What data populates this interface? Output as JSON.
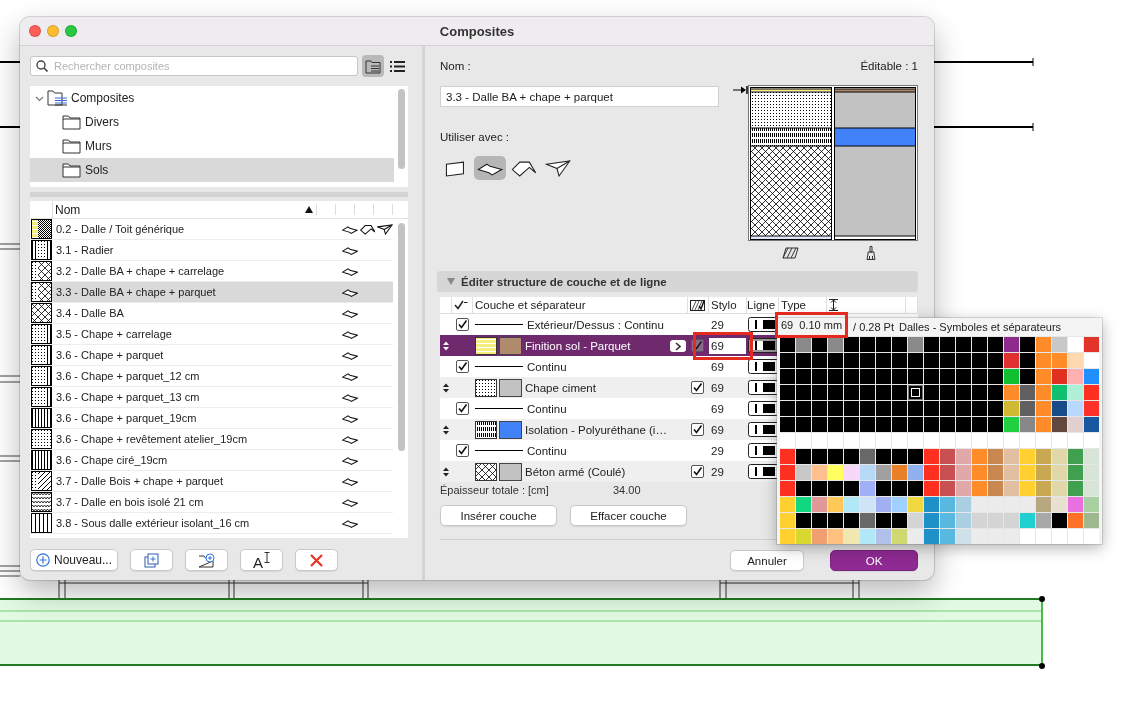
{
  "window": {
    "title": "Composites"
  },
  "search": {
    "placeholder": "Rechercher composites"
  },
  "view_toggle": [
    {
      "kind": "tree",
      "selected": true
    },
    {
      "kind": "list",
      "selected": false
    }
  ],
  "tree": [
    {
      "label": "Composites",
      "expanded": true,
      "selected": false,
      "children": [
        {
          "label": "Divers",
          "selected": false
        },
        {
          "label": "Murs",
          "selected": false
        },
        {
          "label": "Sols",
          "selected": true
        }
      ]
    }
  ],
  "list": {
    "columns": [
      "Nom"
    ],
    "rows": [
      {
        "name": "0.2 - Dalle / Toit générique",
        "kind": "mixed",
        "roof": true,
        "shell": true,
        "selected": false
      },
      {
        "name": "3.1 - Radier",
        "kind": "radier",
        "roof": false,
        "shell": false,
        "selected": false
      },
      {
        "name": "3.2 - Dalle BA + chape + carrelage",
        "kind": "cross",
        "roof": false,
        "shell": false,
        "selected": false
      },
      {
        "name": "3.3 - Dalle BA + chape + parquet",
        "kind": "cross",
        "roof": false,
        "shell": false,
        "selected": true
      },
      {
        "name": "3.4 - Dalle BA",
        "kind": "xcross",
        "roof": false,
        "shell": false,
        "selected": false
      },
      {
        "name": "3.5 - Chape + carrelage",
        "kind": "dots",
        "roof": false,
        "shell": false,
        "selected": false
      },
      {
        "name": "3.6 - Chape + parquet",
        "kind": "dots",
        "roof": false,
        "shell": false,
        "selected": false
      },
      {
        "name": "3.6 - Chape + parquet_12 cm",
        "kind": "dots",
        "roof": false,
        "shell": false,
        "selected": false
      },
      {
        "name": "3.6 - Chape + parquet_13 cm",
        "kind": "dots",
        "roof": false,
        "shell": false,
        "selected": false
      },
      {
        "name": "3.6 - Chape + parquet_19cm",
        "kind": "stripes",
        "roof": false,
        "shell": false,
        "selected": false
      },
      {
        "name": "3.6 - Chape + revêtement atelier_19cm",
        "kind": "speckle",
        "roof": false,
        "shell": false,
        "selected": false
      },
      {
        "name": "3.6 - Chape ciré_19cm",
        "kind": "stripes",
        "roof": false,
        "shell": false,
        "selected": false
      },
      {
        "name": "3.7 - Dalle Bois + chape + parquet",
        "kind": "diagonal",
        "roof": false,
        "shell": false,
        "selected": false
      },
      {
        "name": "3.7 - Dalle en bois isolé 21 cm",
        "kind": "zigzag",
        "roof": false,
        "shell": false,
        "selected": false
      },
      {
        "name": "3.8 - Sous dalle extérieur isolant_16 cm",
        "kind": "lines",
        "roof": false,
        "shell": false,
        "selected": false
      }
    ]
  },
  "left_buttons": [
    {
      "kind": "new",
      "label": "Nouveau..."
    },
    {
      "kind": "duplicate"
    },
    {
      "kind": "new-folder"
    },
    {
      "kind": "rename",
      "label": "A"
    },
    {
      "kind": "delete"
    }
  ],
  "editor": {
    "name_label": "Nom :",
    "editable": "Éditable : 1",
    "name": "3.3 - Dalle BA + chape + parquet",
    "use_with_label": "Utiliser avec :",
    "use_with": [
      {
        "kind": "wall",
        "selected": false
      },
      {
        "kind": "slab",
        "selected": true
      },
      {
        "kind": "roof",
        "selected": false
      },
      {
        "kind": "shell",
        "selected": false
      }
    ]
  },
  "section": {
    "title": "Éditer structure de couche et de ligne",
    "expanded": true
  },
  "layers": {
    "columns": [
      "Couche et séparateur",
      "Stylo",
      "Ligne",
      "Type"
    ],
    "rows": [
      {
        "kind": "line",
        "name": "Extérieur/Dessus : Continu",
        "checked": true,
        "pen": "29",
        "selected": false,
        "highlighted": false
      },
      {
        "kind": "layer",
        "name": "Finition sol - Parquet",
        "color": "#b08a6c",
        "checked": true,
        "pen": "69",
        "selected": true,
        "highlighted": true
      },
      {
        "kind": "line",
        "name": "Continu",
        "checked": true,
        "pen": "69",
        "selected": false,
        "highlighted": false
      },
      {
        "kind": "layer",
        "name": "Chape ciment",
        "color": "#c2c2c2",
        "checked": true,
        "pen": "69",
        "selected": false,
        "highlighted": false
      },
      {
        "kind": "line",
        "name": "Continu",
        "checked": true,
        "pen": "69",
        "selected": false,
        "highlighted": false
      },
      {
        "kind": "layer",
        "name": "Isolation - Polyuréthane (i…",
        "color": "#4282f8",
        "checked": true,
        "pen": "69",
        "selected": false,
        "highlighted": false
      },
      {
        "kind": "line",
        "name": "Continu",
        "checked": true,
        "pen": "29",
        "selected": false,
        "highlighted": false
      },
      {
        "kind": "layer",
        "name": "Béton armé (Coulé)",
        "color": "#c2c2c2",
        "checked": true,
        "pen": "29",
        "selected": false,
        "highlighted": false
      }
    ]
  },
  "total": {
    "label": "Épaisseur totale : [cm]",
    "value": "34.00"
  },
  "layer_buttons": [
    "Insérer couche",
    "Effacer couche"
  ],
  "footer_buttons": [
    {
      "kind": "cancel",
      "label": "Annuler"
    },
    {
      "kind": "ok",
      "label": "OK"
    }
  ],
  "pen_popup": {
    "pen": "69",
    "width": "0.10 mm",
    "points": "/ 0.28 Pt",
    "set": "Dalles - Symboles et séparateurs",
    "highlighted": true,
    "rows": [
      [
        {
          "color": "#000000",
          "selected": false
        },
        {
          "color": "#8a8a8a",
          "selected": false
        },
        {
          "color": "#000000",
          "selected": false
        },
        {
          "color": "#8a8a8a",
          "selected": false
        },
        {
          "color": "#000000",
          "selected": false
        },
        {
          "color": "#000000",
          "selected": false
        },
        {
          "color": "#000000",
          "selected": false
        },
        {
          "color": "#000000",
          "selected": false
        },
        {
          "color": "#8a8a8a",
          "selected": false
        },
        {
          "color": "#000000",
          "selected": false
        },
        {
          "color": "#000000",
          "selected": false
        },
        {
          "color": "#000000",
          "selected": false
        },
        {
          "color": "#000000",
          "selected": false
        },
        {
          "color": "#000000",
          "selected": false
        },
        {
          "color": "#8e2a8e",
          "selected": false
        },
        {
          "color": "#000000",
          "selected": false
        },
        {
          "color": "#ff8c28",
          "selected": false
        },
        {
          "color": "#c8c8c8",
          "selected": false
        },
        {
          "color": "#ffffff",
          "selected": false
        },
        {
          "color": "#e3342a",
          "selected": false
        }
      ],
      [
        {
          "color": "#000000",
          "selected": false
        },
        {
          "color": "#000000",
          "selected": false
        },
        {
          "color": "#000000",
          "selected": false
        },
        {
          "color": "#000000",
          "selected": false
        },
        {
          "color": "#000000",
          "selected": false
        },
        {
          "color": "#000000",
          "selected": false
        },
        {
          "color": "#000000",
          "selected": false
        },
        {
          "color": "#000000",
          "selected": false
        },
        {
          "color": "#000000",
          "selected": false
        },
        {
          "color": "#000000",
          "selected": false
        },
        {
          "color": "#000000",
          "selected": false
        },
        {
          "color": "#000000",
          "selected": false
        },
        {
          "color": "#000000",
          "selected": false
        },
        {
          "color": "#000000",
          "selected": false
        },
        {
          "color": "#e03030",
          "selected": false
        },
        {
          "color": "#000000",
          "selected": false
        },
        {
          "color": "#ff8c28",
          "selected": false
        },
        {
          "color": "#ff8c28",
          "selected": false
        },
        {
          "color": "#ffd8b0",
          "selected": false
        },
        {
          "color": "#ffffff",
          "selected": false
        }
      ],
      [
        {
          "color": "#000000",
          "selected": false
        },
        {
          "color": "#000000",
          "selected": false
        },
        {
          "color": "#000000",
          "selected": false
        },
        {
          "color": "#000000",
          "selected": false
        },
        {
          "color": "#000000",
          "selected": false
        },
        {
          "color": "#000000",
          "selected": false
        },
        {
          "color": "#000000",
          "selected": false
        },
        {
          "color": "#000000",
          "selected": false
        },
        {
          "color": "#000000",
          "selected": false
        },
        {
          "color": "#000000",
          "selected": false
        },
        {
          "color": "#000000",
          "selected": false
        },
        {
          "color": "#000000",
          "selected": false
        },
        {
          "color": "#000000",
          "selected": false
        },
        {
          "color": "#000000",
          "selected": false
        },
        {
          "color": "#10c030",
          "selected": false
        },
        {
          "color": "#000000",
          "selected": false
        },
        {
          "color": "#ff8c28",
          "selected": false
        },
        {
          "color": "#e03020",
          "selected": false
        },
        {
          "color": "#ffb0b0",
          "selected": false
        },
        {
          "color": "#2090ff",
          "selected": false
        }
      ],
      [
        {
          "color": "#000000",
          "selected": false
        },
        {
          "color": "#000000",
          "selected": false
        },
        {
          "color": "#000000",
          "selected": false
        },
        {
          "color": "#000000",
          "selected": false
        },
        {
          "color": "#000000",
          "selected": false
        },
        {
          "color": "#000000",
          "selected": false
        },
        {
          "color": "#000000",
          "selected": false
        },
        {
          "color": "#000000",
          "selected": false
        },
        {
          "color": "#000000",
          "selected": true
        },
        {
          "color": "#000000",
          "selected": false
        },
        {
          "color": "#000000",
          "selected": false
        },
        {
          "color": "#000000",
          "selected": false
        },
        {
          "color": "#000000",
          "selected": false
        },
        {
          "color": "#000000",
          "selected": false
        },
        {
          "color": "#ff8c28",
          "selected": false
        },
        {
          "color": "#606060",
          "selected": false
        },
        {
          "color": "#ff8c28",
          "selected": false
        },
        {
          "color": "#10c070",
          "selected": false
        },
        {
          "color": "#b0f0d8",
          "selected": false
        },
        {
          "color": "#ff3020",
          "selected": false
        }
      ],
      [
        {
          "color": "#000000",
          "selected": false
        },
        {
          "color": "#000000",
          "selected": false
        },
        {
          "color": "#000000",
          "selected": false
        },
        {
          "color": "#000000",
          "selected": false
        },
        {
          "color": "#000000",
          "selected": false
        },
        {
          "color": "#000000",
          "selected": false
        },
        {
          "color": "#000000",
          "selected": false
        },
        {
          "color": "#000000",
          "selected": false
        },
        {
          "color": "#000000",
          "selected": false
        },
        {
          "color": "#000000",
          "selected": false
        },
        {
          "color": "#000000",
          "selected": false
        },
        {
          "color": "#000000",
          "selected": false
        },
        {
          "color": "#000000",
          "selected": false
        },
        {
          "color": "#000000",
          "selected": false
        },
        {
          "color": "#d0b830",
          "selected": false
        },
        {
          "color": "#606060",
          "selected": false
        },
        {
          "color": "#ff8c28",
          "selected": false
        },
        {
          "color": "#184c88",
          "selected": false
        },
        {
          "color": "#b8d8ff",
          "selected": false
        },
        {
          "color": "#ff3028",
          "selected": false
        }
      ],
      [
        {
          "color": "#000000",
          "selected": false
        },
        {
          "color": "#000000",
          "selected": false
        },
        {
          "color": "#000000",
          "selected": false
        },
        {
          "color": "#000000",
          "selected": false
        },
        {
          "color": "#000000",
          "selected": false
        },
        {
          "color": "#000000",
          "selected": false
        },
        {
          "color": "#000000",
          "selected": false
        },
        {
          "color": "#000000",
          "selected": false
        },
        {
          "color": "#000000",
          "selected": false
        },
        {
          "color": "#000000",
          "selected": false
        },
        {
          "color": "#000000",
          "selected": false
        },
        {
          "color": "#000000",
          "selected": false
        },
        {
          "color": "#000000",
          "selected": false
        },
        {
          "color": "#000000",
          "selected": false
        },
        {
          "color": "#20d040",
          "selected": false
        },
        {
          "color": "#888888",
          "selected": false
        },
        {
          "color": "#ff8c28",
          "selected": false
        },
        {
          "color": "#604840",
          "selected": false
        },
        {
          "color": "#e0d0d0",
          "selected": false
        },
        {
          "color": "#1858a0",
          "selected": false
        }
      ],
      [
        {
          "color": "#ffffff",
          "selected": false
        },
        {
          "color": "#ffffff",
          "selected": false
        },
        {
          "color": "#ffffff",
          "selected": false
        },
        {
          "color": "#ffffff",
          "selected": false
        },
        {
          "color": "#ffffff",
          "selected": false
        },
        {
          "color": "#ffffff",
          "selected": false
        },
        {
          "color": "#ffffff",
          "selected": false
        },
        {
          "color": "#ffffff",
          "selected": false
        },
        {
          "color": "#ffffff",
          "selected": false
        },
        {
          "color": "#ffffff",
          "selected": false
        },
        {
          "color": "#ffffff",
          "selected": false
        },
        {
          "color": "#ffffff",
          "selected": false
        },
        {
          "color": "#ffffff",
          "selected": false
        },
        {
          "color": "#ffffff",
          "selected": false
        },
        {
          "color": "#ffffff",
          "selected": false
        },
        {
          "color": "#ffffff",
          "selected": false
        },
        {
          "color": "#ffffff",
          "selected": false
        },
        {
          "color": "#ffffff",
          "selected": false
        },
        {
          "color": "#ffffff",
          "selected": false
        },
        {
          "color": "#ffffff",
          "selected": false
        }
      ],
      [
        {
          "color": "#ff3020",
          "selected": false
        },
        {
          "color": "#000000",
          "selected": false
        },
        {
          "color": "#000000",
          "selected": false
        },
        {
          "color": "#000000",
          "selected": false
        },
        {
          "color": "#000000",
          "selected": false
        },
        {
          "color": "#686868",
          "selected": false
        },
        {
          "color": "#000000",
          "selected": false
        },
        {
          "color": "#000000",
          "selected": false
        },
        {
          "color": "#000000",
          "selected": false
        },
        {
          "color": "#ff3020",
          "selected": false
        },
        {
          "color": "#c85050",
          "selected": false
        },
        {
          "color": "#e0a8a8",
          "selected": false
        },
        {
          "color": "#ff8c28",
          "selected": false
        },
        {
          "color": "#c88850",
          "selected": false
        },
        {
          "color": "#e0c0a0",
          "selected": false
        },
        {
          "color": "#ffd030",
          "selected": false
        },
        {
          "color": "#c8a850",
          "selected": false
        },
        {
          "color": "#e0d8a8",
          "selected": false
        },
        {
          "color": "#40a050",
          "selected": false
        },
        {
          "color": "#d8e4d8",
          "selected": false
        }
      ],
      [
        {
          "color": "#ff3020",
          "selected": false
        },
        {
          "color": "#c8c8c8",
          "selected": false
        },
        {
          "color": "#ffc090",
          "selected": false
        },
        {
          "color": "#ffff60",
          "selected": false
        },
        {
          "color": "#f8d8f8",
          "selected": false
        },
        {
          "color": "#b8d8f8",
          "selected": false
        },
        {
          "color": "#a0a0a0",
          "selected": false
        },
        {
          "color": "#e88028",
          "selected": false
        },
        {
          "color": "#90b0f0",
          "selected": false
        },
        {
          "color": "#ff3020",
          "selected": false
        },
        {
          "color": "#c85050",
          "selected": false
        },
        {
          "color": "#e0a8a8",
          "selected": false
        },
        {
          "color": "#ff8c28",
          "selected": false
        },
        {
          "color": "#c88850",
          "selected": false
        },
        {
          "color": "#e0c0a0",
          "selected": false
        },
        {
          "color": "#ffd030",
          "selected": false
        },
        {
          "color": "#c8a850",
          "selected": false
        },
        {
          "color": "#e0d8a8",
          "selected": false
        },
        {
          "color": "#40a050",
          "selected": false
        },
        {
          "color": "#d8e4d8",
          "selected": false
        }
      ],
      [
        {
          "color": "#ff3020",
          "selected": false
        },
        {
          "color": "#000000",
          "selected": false
        },
        {
          "color": "#000000",
          "selected": false
        },
        {
          "color": "#000000",
          "selected": false
        },
        {
          "color": "#000000",
          "selected": false
        },
        {
          "color": "#a0b0f8",
          "selected": false
        },
        {
          "color": "#000000",
          "selected": false
        },
        {
          "color": "#000000",
          "selected": false
        },
        {
          "color": "#000000",
          "selected": false
        },
        {
          "color": "#ff3020",
          "selected": false
        },
        {
          "color": "#c85050",
          "selected": false
        },
        {
          "color": "#e0a8a8",
          "selected": false
        },
        {
          "color": "#ff8c28",
          "selected": false
        },
        {
          "color": "#c88850",
          "selected": false
        },
        {
          "color": "#e0c0a0",
          "selected": false
        },
        {
          "color": "#ffd030",
          "selected": false
        },
        {
          "color": "#c8a850",
          "selected": false
        },
        {
          "color": "#e0d8a8",
          "selected": false
        },
        {
          "color": "#40a050",
          "selected": false
        },
        {
          "color": "#d8e4d8",
          "selected": false
        }
      ],
      [
        {
          "color": "#ffd030",
          "selected": false
        },
        {
          "color": "#10d880",
          "selected": false
        },
        {
          "color": "#e09898",
          "selected": false
        },
        {
          "color": "#ffc858",
          "selected": false
        },
        {
          "color": "#b0e8f8",
          "selected": false
        },
        {
          "color": "#d0e4f8",
          "selected": false
        },
        {
          "color": "#a0b0f0",
          "selected": false
        },
        {
          "color": "#a0d0ff",
          "selected": false
        },
        {
          "color": "#f0d840",
          "selected": false
        },
        {
          "color": "#2090c8",
          "selected": false
        },
        {
          "color": "#58b8e0",
          "selected": false
        },
        {
          "color": "#a8d0e0",
          "selected": false
        },
        {
          "color": "#ececec",
          "selected": false
        },
        {
          "color": "#ececec",
          "selected": false
        },
        {
          "color": "#ececec",
          "selected": false
        },
        {
          "color": "#ececec",
          "selected": false
        },
        {
          "color": "#b8a880",
          "selected": false
        },
        {
          "color": "#e8e0d0",
          "selected": false
        },
        {
          "color": "#e870e0",
          "selected": false
        },
        {
          "color": "#a8d0a0",
          "selected": false
        }
      ],
      [
        {
          "color": "#ffd030",
          "selected": false
        },
        {
          "color": "#000000",
          "selected": false
        },
        {
          "color": "#000000",
          "selected": false
        },
        {
          "color": "#000000",
          "selected": false
        },
        {
          "color": "#000000",
          "selected": false
        },
        {
          "color": "#686868",
          "selected": false
        },
        {
          "color": "#000000",
          "selected": false
        },
        {
          "color": "#000000",
          "selected": false
        },
        {
          "color": "#d4d4d4",
          "selected": false
        },
        {
          "color": "#2090c8",
          "selected": false
        },
        {
          "color": "#58b8e0",
          "selected": false
        },
        {
          "color": "#a8d0e0",
          "selected": false
        },
        {
          "color": "#d4d4d4",
          "selected": false
        },
        {
          "color": "#d4d4d4",
          "selected": false
        },
        {
          "color": "#d4d4d4",
          "selected": false
        },
        {
          "color": "#20d0d0",
          "selected": false
        },
        {
          "color": "#a8a8a8",
          "selected": false
        },
        {
          "color": "#000000",
          "selected": false
        },
        {
          "color": "#ff7028",
          "selected": false
        },
        {
          "color": "#a0b890",
          "selected": false
        }
      ],
      [
        {
          "color": "#ffd030",
          "selected": false
        },
        {
          "color": "#d8d830",
          "selected": false
        },
        {
          "color": "#f0a070",
          "selected": false
        },
        {
          "color": "#ffc080",
          "selected": false
        },
        {
          "color": "#f0e8b0",
          "selected": false
        },
        {
          "color": "#b0e8f8",
          "selected": false
        },
        {
          "color": "#b0c0e8",
          "selected": false
        },
        {
          "color": "#d0d870",
          "selected": false
        },
        {
          "color": "#ececec",
          "selected": false
        },
        {
          "color": "#2090c8",
          "selected": false
        },
        {
          "color": "#58b8e0",
          "selected": false
        },
        {
          "color": "#d0e0e8",
          "selected": false
        },
        {
          "color": "#ececec",
          "selected": false
        },
        {
          "color": "#ececec",
          "selected": false
        },
        {
          "color": "#ececec",
          "selected": false
        },
        {
          "color": "#ffffff",
          "selected": false
        },
        {
          "color": "#ffffff",
          "selected": false
        },
        {
          "color": "#ffffff",
          "selected": false
        },
        {
          "color": "#ffffff",
          "selected": false
        },
        {
          "color": "#ffffff",
          "selected": false
        }
      ]
    ]
  }
}
